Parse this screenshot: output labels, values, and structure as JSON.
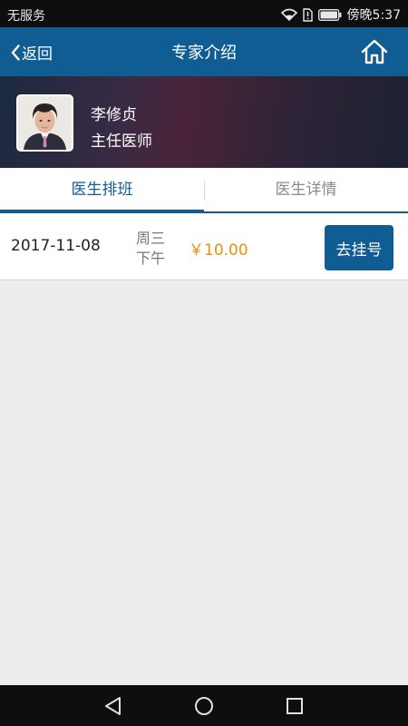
{
  "status_bar": {
    "carrier": "无服务",
    "time": "傍晚5:37"
  },
  "nav": {
    "back_label": "返回",
    "title": "专家介绍"
  },
  "doctor": {
    "name": "李修贞",
    "title": "主任医师"
  },
  "tabs": [
    {
      "label": "医生排班",
      "active": true
    },
    {
      "label": "医生详情",
      "active": false
    }
  ],
  "schedule": [
    {
      "date": "2017-11-08",
      "weekday": "周三",
      "period": "下午",
      "price": "￥10.00",
      "action_label": "去挂号"
    }
  ],
  "colors": {
    "primary": "#0f5d93",
    "price": "#e7900e"
  }
}
